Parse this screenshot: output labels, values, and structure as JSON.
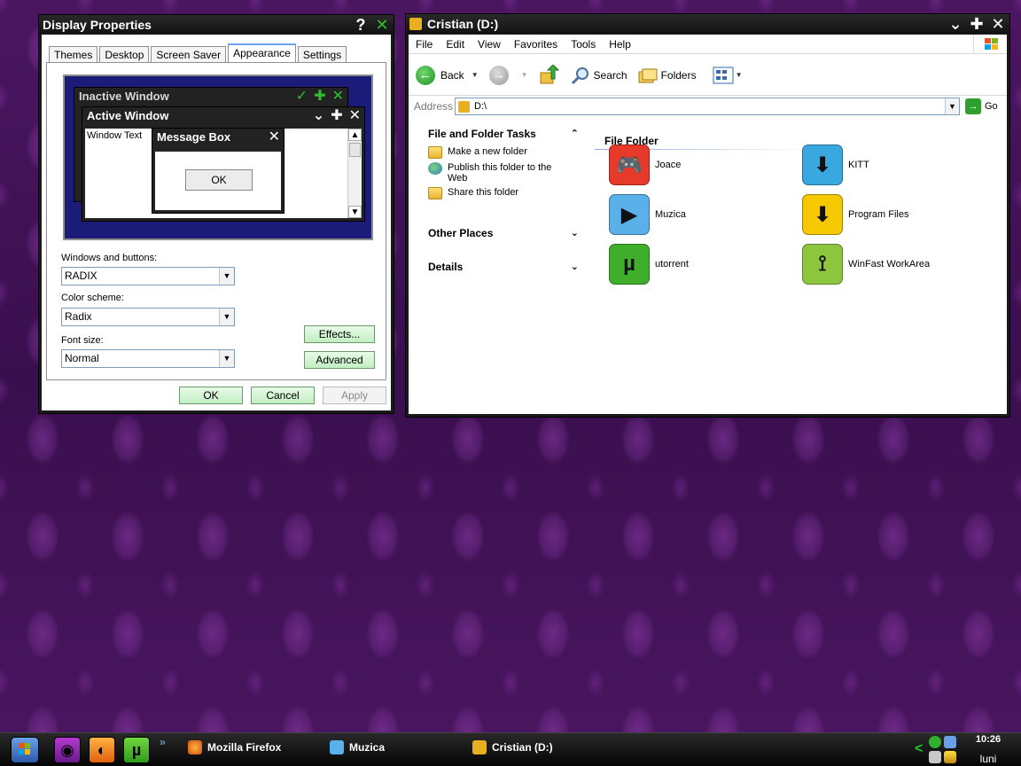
{
  "display_properties": {
    "title": "Display Properties",
    "help_btn": "?",
    "tabs": [
      {
        "label": "Themes"
      },
      {
        "label": "Desktop"
      },
      {
        "label": "Screen Saver"
      },
      {
        "label": "Appearance"
      },
      {
        "label": "Settings"
      }
    ],
    "active_tab": "Appearance",
    "preview": {
      "inactive_title": "Inactive Window",
      "active_title": "Active Window",
      "window_text": "Window Text",
      "message_title": "Message Box",
      "ok": "OK"
    },
    "windows_buttons": {
      "label": "Windows and buttons:",
      "value": "RADIX"
    },
    "color_scheme": {
      "label": "Color scheme:",
      "value": "Radix"
    },
    "font_size": {
      "label": "Font size:",
      "value": "Normal"
    },
    "effects_btn": "Effects...",
    "advanced_btn": "Advanced",
    "ok_btn": "OK",
    "cancel_btn": "Cancel",
    "apply_btn": "Apply"
  },
  "explorer": {
    "title": "Cristian (D:)",
    "menu": [
      "File",
      "Edit",
      "View",
      "Favorites",
      "Tools",
      "Help"
    ],
    "toolbar": {
      "back": "Back",
      "search": "Search",
      "folders": "Folders"
    },
    "address": {
      "label": "Address",
      "value": "D:\\",
      "go": "Go"
    },
    "tasks": {
      "header": "File and Folder Tasks",
      "items": [
        "Make a new folder",
        "Publish this folder to the Web",
        "Share this folder"
      ]
    },
    "other_places": "Other Places",
    "details": "Details",
    "group_header": "File Folder",
    "items": [
      {
        "name": "Joace",
        "color": "#e83a2a",
        "glyph": "🎮"
      },
      {
        "name": "KITT",
        "color": "#3aa8e0",
        "glyph": "⬇"
      },
      {
        "name": "Muzica",
        "color": "#5ab0e8",
        "glyph": "▶"
      },
      {
        "name": "Program Files",
        "color": "#f5c800",
        "glyph": "⬇"
      },
      {
        "name": "utorrent",
        "color": "#3fae2a",
        "glyph": "µ"
      },
      {
        "name": "WinFast WorkArea",
        "color": "#8cc63f",
        "glyph": "⟟"
      }
    ]
  },
  "taskbar": {
    "tasks": [
      "Mozilla Firefox",
      "Muzica",
      "Cristian (D:)"
    ],
    "quicklaunch_more": "»",
    "tray_arrow": "<",
    "time": "10:26",
    "day": "luni"
  }
}
